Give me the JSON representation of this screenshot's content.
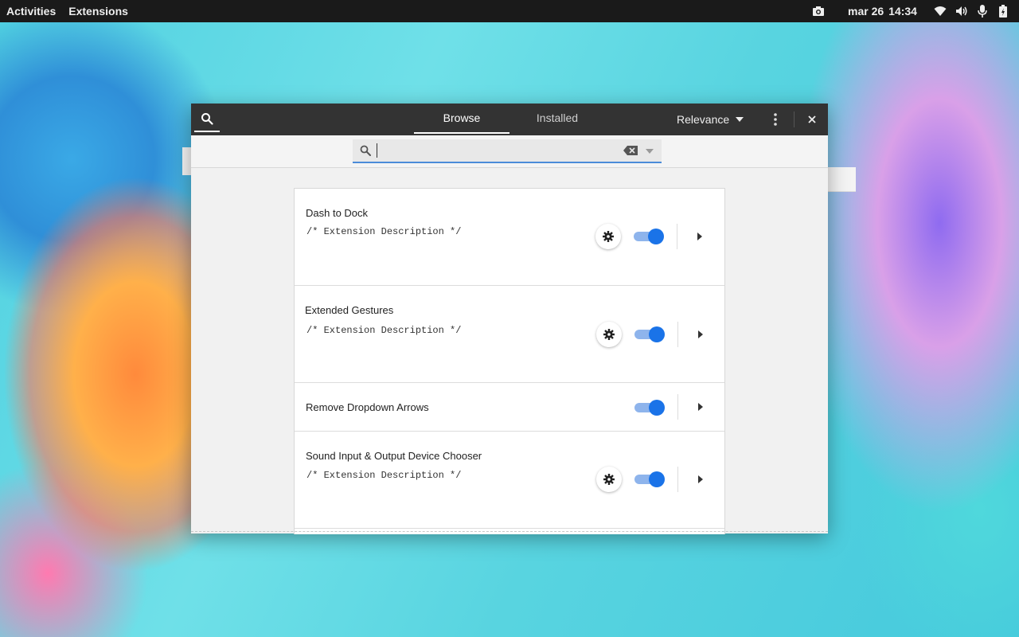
{
  "topbar": {
    "activities": "Activities",
    "app_menu": "Extensions",
    "date": "mar 26",
    "time": "14:34",
    "icons": [
      "screenshot-icon",
      "wifi-icon",
      "volume-icon",
      "microphone-icon",
      "battery-icon"
    ]
  },
  "window": {
    "tabs": [
      {
        "label": "Browse",
        "active": true
      },
      {
        "label": "Installed",
        "active": false
      }
    ],
    "sort_label": "Relevance",
    "search": {
      "value": "",
      "placeholder": ""
    },
    "extensions": [
      {
        "name": "Dash to Dock",
        "description": "/* Extension Description */",
        "has_settings": true,
        "enabled": true
      },
      {
        "name": "Extended Gestures",
        "description": "/* Extension Description */",
        "has_settings": true,
        "enabled": true
      },
      {
        "name": "Remove Dropdown Arrows",
        "description": "",
        "has_settings": false,
        "enabled": true
      },
      {
        "name": "Sound Input & Output Device Chooser",
        "description": "/* Extension Description */",
        "has_settings": true,
        "enabled": true
      }
    ]
  },
  "colors": {
    "accent": "#1a73e8",
    "toggle_track": "#8eb4ec",
    "headerbar": "#333333",
    "topbar": "#1a1a1a"
  }
}
